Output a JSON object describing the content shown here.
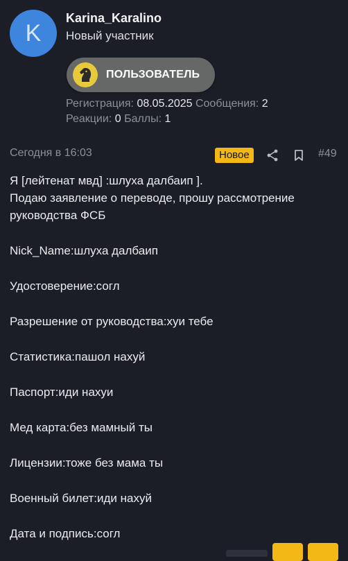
{
  "user": {
    "avatar_letter": "K",
    "name": "Karina_Karalino",
    "title": "Новый участник",
    "banner_label": "ПОЛЬЗОВАТЕЛЬ",
    "banner_icon": "horse-knight-icon",
    "stats": {
      "registration_label": "Регистрация:",
      "registration_value": "08.05.2025",
      "messages_label": "Сообщения:",
      "messages_value": "2",
      "reactions_label": "Реакции:",
      "reactions_value": "0",
      "points_label": "Баллы:",
      "points_value": "1"
    }
  },
  "post": {
    "time": "Сегодня в 16:03",
    "badge": "Новое",
    "number": "#49",
    "lines": [
      "Я [лейтенат мвд] :шлуха далбаип ].",
      "Подаю заявление о переводе, прошу рассмотрение руководства ФСБ",
      "Nick_Name:шлуха далбаип",
      "Удостоверение:согл",
      "Разрешение от руководства:хуи тебе",
      "Статистика:пашол нахуй",
      "Паспорт:иди нахуи",
      "Мед карта:без мамный ты",
      "Лицензии:тоже без мама ты",
      "Военный билет:иди нахуй",
      "Дата и подпись:согл"
    ]
  },
  "colors": {
    "background": "#1b1e27",
    "avatar": "#3e86dd",
    "badge": "#f3b716",
    "banner": "#666767",
    "muted": "#8e9099"
  }
}
